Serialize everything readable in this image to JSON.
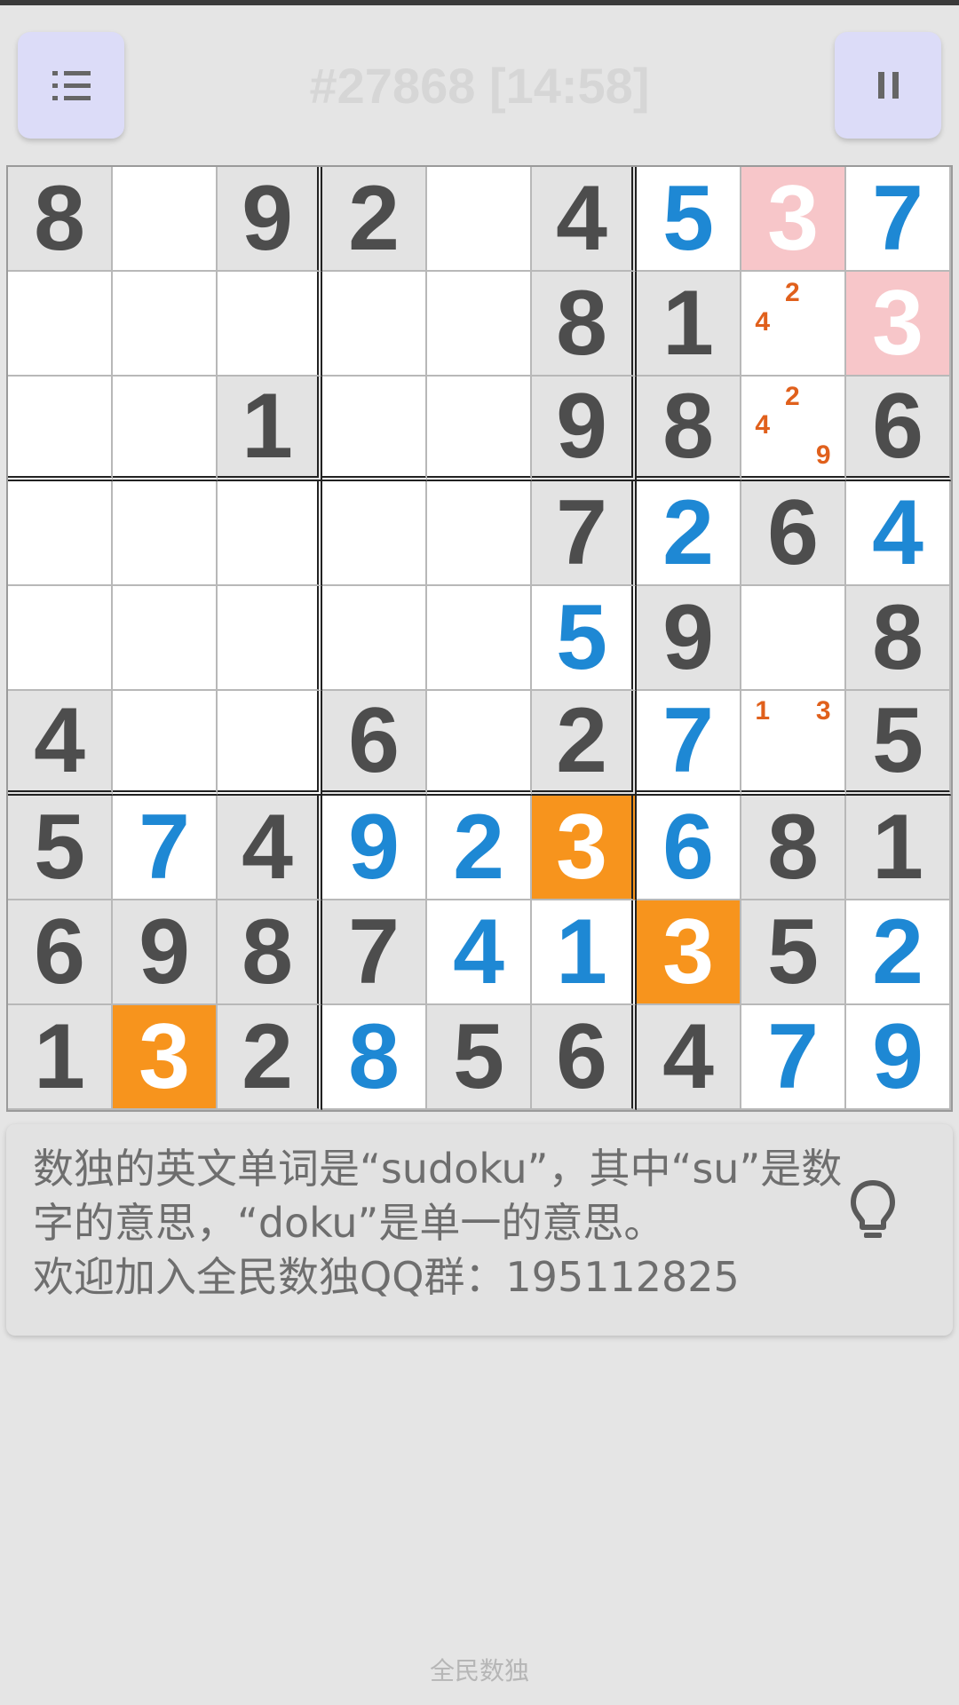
{
  "header": {
    "title": "#27868 [14:58]",
    "menu_icon": "list-icon",
    "pause_icon": "pause-icon"
  },
  "colors": {
    "background": "#e5e5e5",
    "given_cell": "#e3e3e3",
    "given_digit": "#4d4d4d",
    "user_digit": "#1e88d4",
    "error_cell": "#f7c6c9",
    "highlight_cell": "#f7941d",
    "note_digit": "#e0601c",
    "button": "#dcdcf8"
  },
  "board": {
    "rows": [
      [
        {
          "v": "8",
          "t": "given"
        },
        {
          "v": "",
          "t": "empty"
        },
        {
          "v": "9",
          "t": "given"
        },
        {
          "v": "2",
          "t": "given"
        },
        {
          "v": "",
          "t": "empty"
        },
        {
          "v": "4",
          "t": "given"
        },
        {
          "v": "5",
          "t": "user"
        },
        {
          "v": "3",
          "t": "error"
        },
        {
          "v": "7",
          "t": "user"
        }
      ],
      [
        {
          "v": "",
          "t": "empty"
        },
        {
          "v": "",
          "t": "empty"
        },
        {
          "v": "",
          "t": "empty"
        },
        {
          "v": "",
          "t": "empty"
        },
        {
          "v": "",
          "t": "empty"
        },
        {
          "v": "8",
          "t": "given"
        },
        {
          "v": "1",
          "t": "given"
        },
        {
          "v": "",
          "t": "empty",
          "notes": [
            "2",
            "4"
          ]
        },
        {
          "v": "3",
          "t": "error"
        }
      ],
      [
        {
          "v": "",
          "t": "empty"
        },
        {
          "v": "",
          "t": "empty"
        },
        {
          "v": "1",
          "t": "given"
        },
        {
          "v": "",
          "t": "empty"
        },
        {
          "v": "",
          "t": "empty"
        },
        {
          "v": "9",
          "t": "given"
        },
        {
          "v": "8",
          "t": "given"
        },
        {
          "v": "",
          "t": "empty",
          "notes": [
            "2",
            "4",
            "9"
          ]
        },
        {
          "v": "6",
          "t": "given"
        }
      ],
      [
        {
          "v": "",
          "t": "empty"
        },
        {
          "v": "",
          "t": "empty"
        },
        {
          "v": "",
          "t": "empty"
        },
        {
          "v": "",
          "t": "empty"
        },
        {
          "v": "",
          "t": "empty"
        },
        {
          "v": "7",
          "t": "given"
        },
        {
          "v": "2",
          "t": "user"
        },
        {
          "v": "6",
          "t": "given"
        },
        {
          "v": "4",
          "t": "user"
        }
      ],
      [
        {
          "v": "",
          "t": "empty"
        },
        {
          "v": "",
          "t": "empty"
        },
        {
          "v": "",
          "t": "empty"
        },
        {
          "v": "",
          "t": "empty"
        },
        {
          "v": "",
          "t": "empty"
        },
        {
          "v": "5",
          "t": "user"
        },
        {
          "v": "9",
          "t": "given"
        },
        {
          "v": "",
          "t": "empty"
        },
        {
          "v": "8",
          "t": "given"
        }
      ],
      [
        {
          "v": "4",
          "t": "given"
        },
        {
          "v": "",
          "t": "empty"
        },
        {
          "v": "",
          "t": "empty"
        },
        {
          "v": "6",
          "t": "given"
        },
        {
          "v": "",
          "t": "empty"
        },
        {
          "v": "2",
          "t": "given"
        },
        {
          "v": "7",
          "t": "user"
        },
        {
          "v": "",
          "t": "empty",
          "notes": [
            "1",
            "3"
          ]
        },
        {
          "v": "5",
          "t": "given"
        }
      ],
      [
        {
          "v": "5",
          "t": "given"
        },
        {
          "v": "7",
          "t": "user"
        },
        {
          "v": "4",
          "t": "given"
        },
        {
          "v": "9",
          "t": "user"
        },
        {
          "v": "2",
          "t": "user"
        },
        {
          "v": "3",
          "t": "hl"
        },
        {
          "v": "6",
          "t": "user"
        },
        {
          "v": "8",
          "t": "given"
        },
        {
          "v": "1",
          "t": "given"
        }
      ],
      [
        {
          "v": "6",
          "t": "given"
        },
        {
          "v": "9",
          "t": "given"
        },
        {
          "v": "8",
          "t": "given"
        },
        {
          "v": "7",
          "t": "given"
        },
        {
          "v": "4",
          "t": "user"
        },
        {
          "v": "1",
          "t": "user"
        },
        {
          "v": "3",
          "t": "hl"
        },
        {
          "v": "5",
          "t": "given"
        },
        {
          "v": "2",
          "t": "user"
        }
      ],
      [
        {
          "v": "1",
          "t": "given"
        },
        {
          "v": "3",
          "t": "hl"
        },
        {
          "v": "2",
          "t": "given"
        },
        {
          "v": "8",
          "t": "user"
        },
        {
          "v": "5",
          "t": "given"
        },
        {
          "v": "6",
          "t": "given"
        },
        {
          "v": "4",
          "t": "given"
        },
        {
          "v": "7",
          "t": "user"
        },
        {
          "v": "9",
          "t": "user"
        }
      ]
    ]
  },
  "tip": {
    "line1": "数独的英文单词是“sudoku”，其中“su”是数",
    "line2": "字的意思，“doku”是单一的意思。",
    "line3": "欢迎加入全民数独QQ群：195112825",
    "hint_icon": "lightbulb-icon"
  },
  "footer": {
    "label": "全民数独"
  }
}
